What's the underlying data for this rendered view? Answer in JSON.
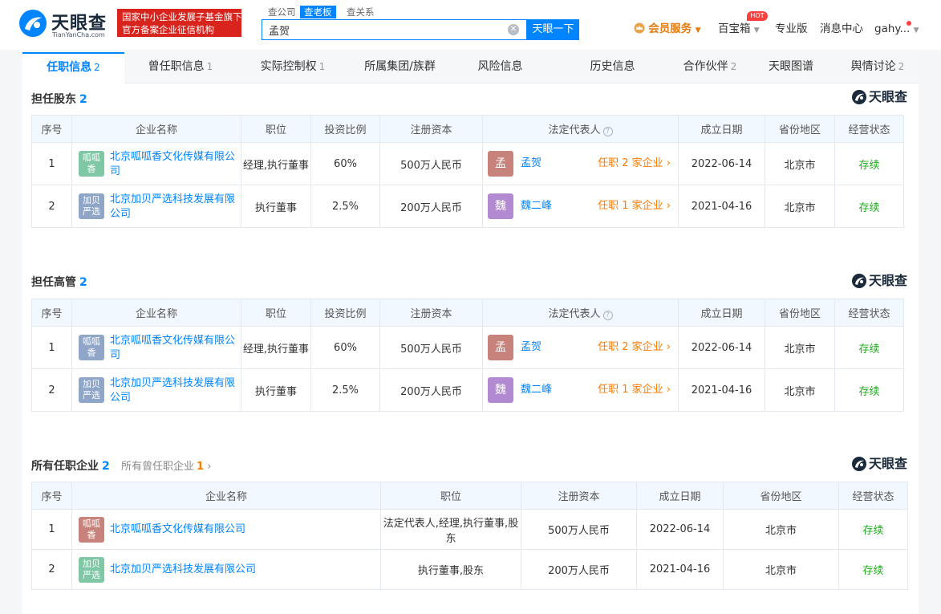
{
  "header": {
    "logo_text": "天眼查",
    "logo_sub": "TianYanCha.com",
    "badge_line1": "国家中小企业发展子基金旗下",
    "badge_line2": "官方备案企业征信机构",
    "search_tabs": [
      "查公司",
      "查老板",
      "查关系"
    ],
    "search_value": "孟贺",
    "search_button": "天眼一下",
    "vip": "会员服务",
    "baibaoxiang": "百宝箱",
    "hot": "HOT",
    "pro": "专业版",
    "messages": "消息中心",
    "user": "gahy..."
  },
  "tabs": [
    {
      "label": "任职信息",
      "count": "2"
    },
    {
      "label": "曾任职信息",
      "count": "1"
    },
    {
      "label": "实际控制权",
      "count": "1"
    },
    {
      "label": "所属集团/族群",
      "count": ""
    },
    {
      "label": "风险信息",
      "count": ""
    },
    {
      "label": "历史信息",
      "count": ""
    },
    {
      "label": "合作伙伴",
      "count": "2"
    },
    {
      "label": "天眼图谱",
      "count": ""
    },
    {
      "label": "舆情讨论",
      "count": "2"
    }
  ],
  "watermark": "天眼查",
  "colors": {
    "accent": "#0084ff",
    "orange": "#ff7a00",
    "green": "#1aad19",
    "logo_red": "#c8827c",
    "logo_green": "#7fc7a5",
    "logo_blue": "#8fa6c8",
    "avatar_red": "#c8827c",
    "avatar_purple": "#b18ad2"
  },
  "shareholder": {
    "title": "担任股东",
    "count": "2",
    "headers": [
      "序号",
      "企业名称",
      "职位",
      "投资比例",
      "注册资本",
      "法定代表人",
      "成立日期",
      "省份地区",
      "经营状态"
    ],
    "rows": [
      {
        "no": "1",
        "logo": "呱呱香",
        "name": "北京呱呱香文化传媒有限公司",
        "position": "经理,执行董事",
        "ratio": "60%",
        "capital": "500万人民币",
        "rep_avatar": "孟",
        "rep": "孟贺",
        "rep_link": "任职 2 家企业",
        "date": "2022-06-14",
        "region": "北京市",
        "status": "存续"
      },
      {
        "no": "2",
        "logo": "加贝严选",
        "name": "北京加贝严选科技发展有限公司",
        "position": "执行董事",
        "ratio": "2.5%",
        "capital": "200万人民币",
        "rep_avatar": "魏",
        "rep": "魏二峰",
        "rep_link": "任职 1 家企业",
        "date": "2021-04-16",
        "region": "北京市",
        "status": "存续"
      }
    ]
  },
  "executive": {
    "title": "担任高管",
    "count": "2",
    "headers": [
      "序号",
      "企业名称",
      "职位",
      "投资比例",
      "注册资本",
      "法定代表人",
      "成立日期",
      "省份地区",
      "经营状态"
    ],
    "rows": [
      {
        "no": "1",
        "logo": "呱呱香",
        "name": "北京呱呱香文化传媒有限公司",
        "position": "经理,执行董事",
        "ratio": "60%",
        "capital": "500万人民币",
        "rep_avatar": "孟",
        "rep": "孟贺",
        "rep_link": "任职 2 家企业",
        "date": "2022-06-14",
        "region": "北京市",
        "status": "存续"
      },
      {
        "no": "2",
        "logo": "加贝严选",
        "name": "北京加贝严选科技发展有限公司",
        "position": "执行董事",
        "ratio": "2.5%",
        "capital": "200万人民币",
        "rep_avatar": "魏",
        "rep": "魏二峰",
        "rep_link": "任职 1 家企业",
        "date": "2021-04-16",
        "region": "北京市",
        "status": "存续"
      }
    ]
  },
  "all_positions": {
    "title": "所有任职企业",
    "count": "2",
    "former_label": "所有曾任职企业",
    "former_count": "1",
    "headers": [
      "序号",
      "企业名称",
      "职位",
      "注册资本",
      "成立日期",
      "省份地区",
      "经营状态"
    ],
    "rows": [
      {
        "no": "1",
        "logo": "呱呱香",
        "name": "北京呱呱香文化传媒有限公司",
        "position": "法定代表人,经理,执行董事,股东",
        "capital": "500万人民币",
        "date": "2022-06-14",
        "region": "北京市",
        "status": "存续"
      },
      {
        "no": "2",
        "logo": "加贝严选",
        "name": "北京加贝严选科技发展有限公司",
        "position": "执行董事,股东",
        "capital": "200万人民币",
        "date": "2021-04-16",
        "region": "北京市",
        "status": "存续"
      }
    ]
  }
}
